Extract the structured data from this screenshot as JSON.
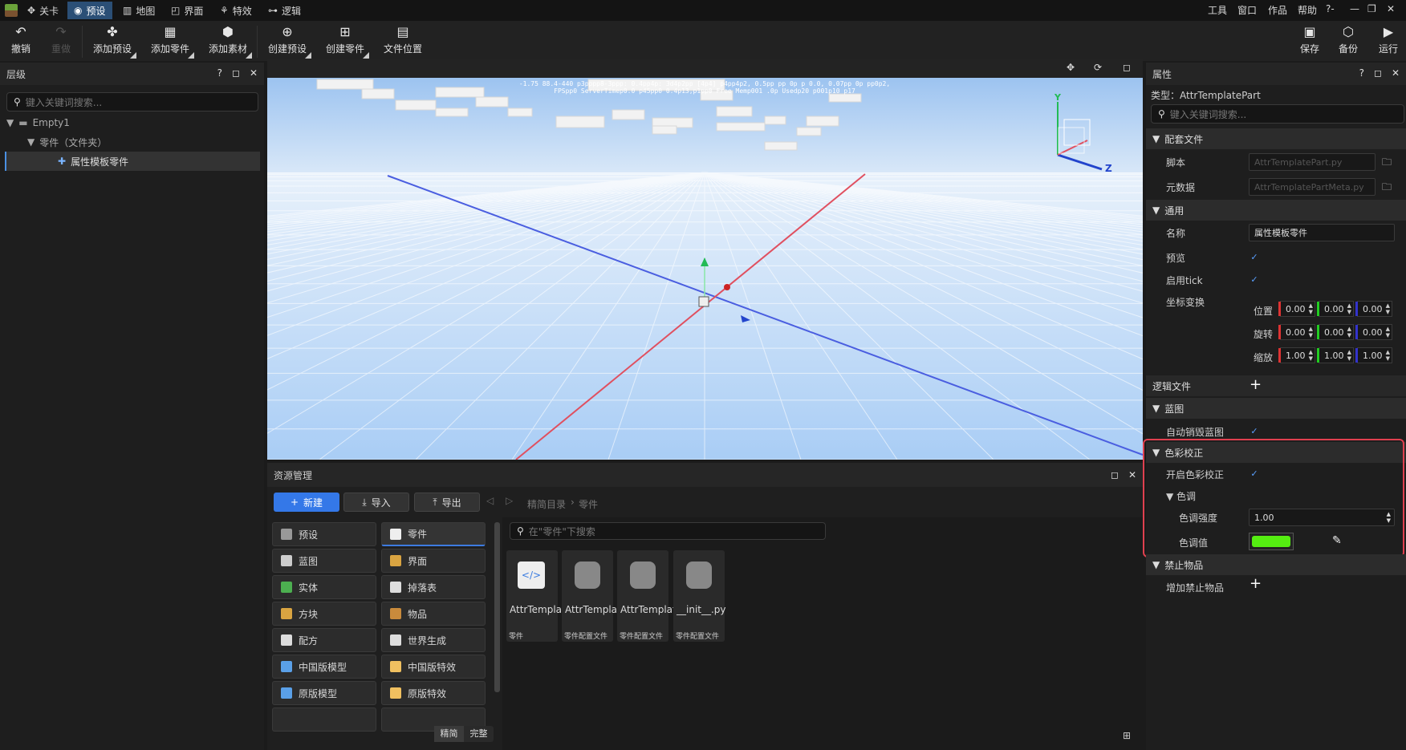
{
  "menubar": {
    "tabs": [
      {
        "label": "关卡"
      },
      {
        "label": "预设"
      },
      {
        "label": "地图"
      },
      {
        "label": "界面"
      },
      {
        "label": "特效"
      },
      {
        "label": "逻辑"
      }
    ],
    "right": {
      "tools": "工具",
      "window": "窗口",
      "works": "作品",
      "help": "帮助",
      "help_icon": "?-"
    }
  },
  "toolbar": {
    "undo": "撤销",
    "redo": "重做",
    "add_preset": "添加预设",
    "add_part": "添加零件",
    "add_asset": "添加素材",
    "create_preset": "创建预设",
    "create_part": "创建零件",
    "file_location": "文件位置",
    "save": "保存",
    "backup": "备份",
    "run": "运行"
  },
  "hierarchy": {
    "title": "层级",
    "search_placeholder": "键入关键词搜索...",
    "items": [
      {
        "label": "Empty1"
      },
      {
        "label": "零件（文件夹）"
      },
      {
        "label": "属性模板零件"
      }
    ]
  },
  "viewport": {
    "debug_line1": "-1.75 88.4-440  p3pppp8-3ppp: 0.4pp4p: 3d4p2pp [4p4]  p4pp4p2, 0.5pp  pp 0p p 0.0, 0.07pp 0p pp0p2,",
    "debug_line2": "FPSpp0  ServerTimep0.0 p45pp0  0.4p13,p1pp0  Free Memp001 .0p  Usedp20 p001p10 p17",
    "axis_y": "Y",
    "axis_z": "Z"
  },
  "assets": {
    "title": "资源管理",
    "new": "新建",
    "import": "导入",
    "export": "导出",
    "breadcrumb_root": "精简目录",
    "breadcrumb_current": "零件",
    "search_placeholder": "在\"零件\"下搜索",
    "categories_left": [
      {
        "label": "预设"
      },
      {
        "label": "蓝图"
      },
      {
        "label": "实体"
      },
      {
        "label": "方块"
      },
      {
        "label": "配方"
      },
      {
        "label": "中国版模型"
      },
      {
        "label": "原版模型"
      }
    ],
    "categories_right": [
      {
        "label": "零件"
      },
      {
        "label": "界面"
      },
      {
        "label": "掉落表"
      },
      {
        "label": "物品"
      },
      {
        "label": "世界生成"
      },
      {
        "label": "中国版特效"
      },
      {
        "label": "原版特效"
      }
    ],
    "files": [
      {
        "name": "AttrTemplate.part",
        "type": "零件"
      },
      {
        "name": "AttrTemplatePart.py",
        "type": "零件配置文件"
      },
      {
        "name": "AttrTemplatePart...",
        "type": "零件配置文件"
      },
      {
        "name": "__init__.py",
        "type": "零件配置文件"
      }
    ],
    "mode_simple": "精简",
    "mode_full": "完整"
  },
  "properties": {
    "title": "属性",
    "type_label": "类型：AttrTemplatePart",
    "search_placeholder": "键入关键词搜索...",
    "sections": {
      "config": "配套文件",
      "general": "通用",
      "logic": "逻辑文件",
      "blueprint": "蓝图",
      "color": "色彩校正",
      "ban": "禁止物品"
    },
    "script_label": "脚本",
    "script_value": "AttrTemplatePart.py",
    "meta_label": "元数据",
    "meta_value": "AttrTemplatePartMeta.py",
    "name_label": "名称",
    "name_value": "属性模板零件",
    "preview_label": "预览",
    "tick_label": "启用tick",
    "transform_label": "坐标变换",
    "position_label": "位置",
    "rotation_label": "旋转",
    "scale_label": "缩放",
    "position": [
      "0.00",
      "0.00",
      "0.00"
    ],
    "rotation": [
      "0.00",
      "0.00",
      "0.00"
    ],
    "scale": [
      "1.00",
      "1.00",
      "1.00"
    ],
    "auto_destroy_label": "自动销毁蓝图",
    "color_enable_label": "开启色彩校正",
    "hue_label": "色调",
    "hue_strength_label": "色调强度",
    "hue_strength_value": "1.00",
    "hue_value_label": "色调值",
    "hue_color": "#55ee11",
    "add_banned_label": "增加禁止物品",
    "highlight_color": "#e0404f"
  }
}
